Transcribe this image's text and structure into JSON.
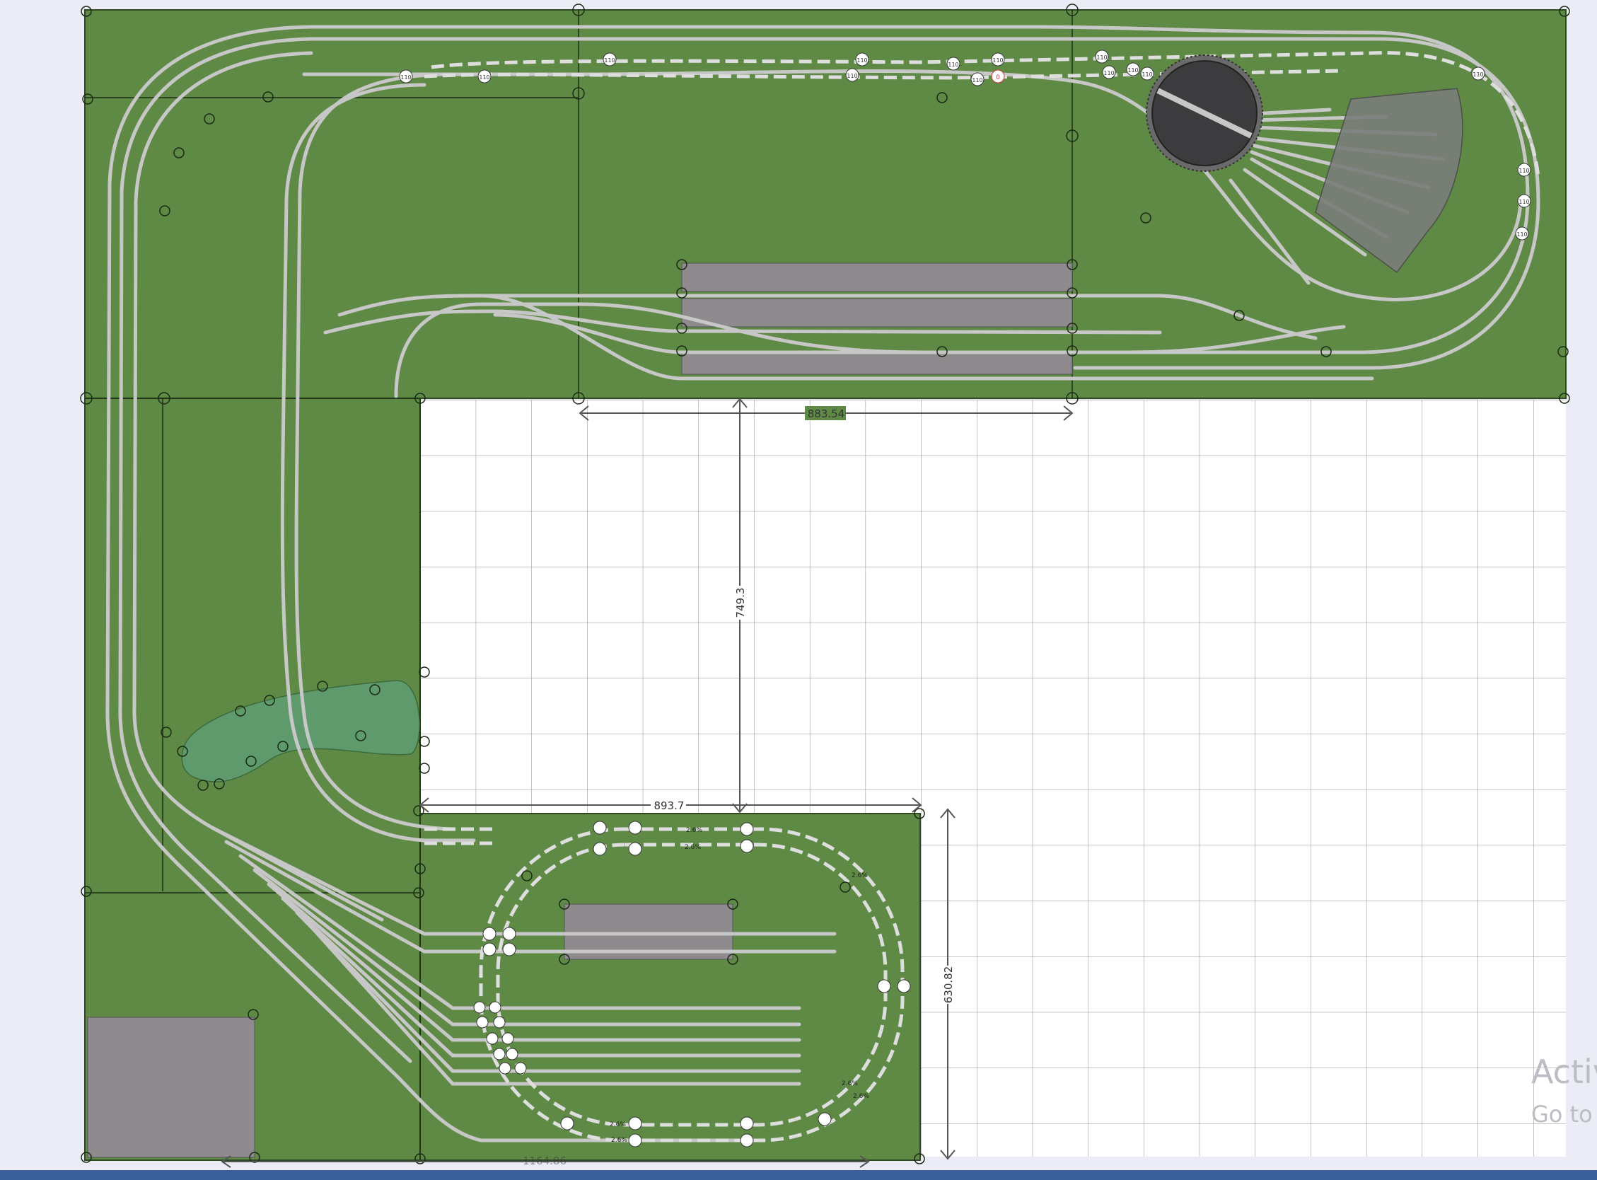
{
  "dimensions": {
    "upper_width": "883.54",
    "inner_height": "749.3",
    "lower_width": "893.7",
    "lower_height": "630.82",
    "bottom_width": "1164.86"
  },
  "labels": {
    "signal_110": "110",
    "signal_0": "0",
    "grade_26": "2.6%"
  },
  "watermark": {
    "line1": "Activ",
    "line2": "Go to"
  },
  "colors": {
    "board": "#5f8a45",
    "track": "#c7c7c7",
    "platform": "#8e8a8e",
    "grid_bg": "#ffffff",
    "grid_line": "#8a8a8a",
    "turntable": "#3c3c3e",
    "pond": "#5f9a6c",
    "taskbar": "#3a5f9a"
  }
}
